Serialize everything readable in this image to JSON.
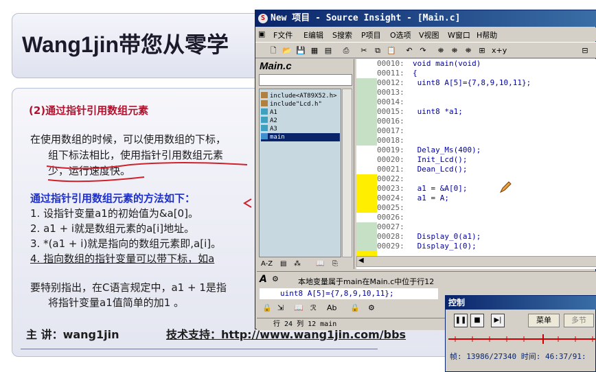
{
  "slide": {
    "title": "Wang1jin带您从零学",
    "heading": "(2)通过指针引用数组元素",
    "para1_line1": "在使用数组的时候，可以使用数组的下标，",
    "para1_line2": "组下标法相比，使用指针引用数组元素",
    "para1_line3": "少，运行速度快。",
    "method_heading": "通过指针引用数组元素的方法如下：",
    "list": [
      "1.  设指针变量a1的初始值为&a[0]。",
      "2.  a1 + i就是数组元素的a[i]地址。",
      "3.  *(a1 + i)就是指向的数组元素即,a[i]。",
      "4.  指向数组的指针变量可以带下标，如a"
    ],
    "note_line1": "要特别指出，在C语言规定中，a1 + 1是指",
    "note_line2": "将指针变量a1值简单的加1 。",
    "footer_speaker": "主 讲：wang1jin",
    "footer_support": "技术支持：http://www.wang1jin.com/bbs"
  },
  "ide": {
    "title": "New 项目 - Source Insight - [Main.c]",
    "menu": [
      "F文件",
      "E编辑",
      "S搜索",
      "P项目",
      "O选项",
      "V视图",
      "W窗口",
      "H帮助"
    ],
    "symbol_title": "Main.c",
    "symbols": [
      {
        "label": "include<AT89X52.h>",
        "kind": "include"
      },
      {
        "label": "include\"Lcd.h\"",
        "kind": "include"
      },
      {
        "label": "A1",
        "kind": "var"
      },
      {
        "label": "A2",
        "kind": "var"
      },
      {
        "label": "A3",
        "kind": "var"
      },
      {
        "label": "main",
        "kind": "func",
        "selected": true
      }
    ],
    "code_lines": [
      {
        "num": "00010:",
        "text": "void main(void)"
      },
      {
        "num": "00011:",
        "text": "{"
      },
      {
        "num": "00012:",
        "text": "    uint8 A[5]={7,8,9,10,11};"
      },
      {
        "num": "00013:",
        "text": ""
      },
      {
        "num": "00014:",
        "text": ""
      },
      {
        "num": "00015:",
        "text": "    uint8 *a1;"
      },
      {
        "num": "00016:",
        "text": ""
      },
      {
        "num": "00017:",
        "text": ""
      },
      {
        "num": "00018:",
        "text": ""
      },
      {
        "num": "00019:",
        "text": "    Delay_Ms(400);"
      },
      {
        "num": "00020:",
        "text": "    Init_Lcd();"
      },
      {
        "num": "00021:",
        "text": "    Dean_Lcd();"
      },
      {
        "num": "00022:",
        "text": ""
      },
      {
        "num": "00023:",
        "text": "    a1 = &A[0];"
      },
      {
        "num": "00024:",
        "text": "    a1 = A;"
      },
      {
        "num": "00025:",
        "text": ""
      },
      {
        "num": "00026:",
        "text": ""
      },
      {
        "num": "00027:",
        "text": ""
      },
      {
        "num": "00028:",
        "text": "    Display_0(a1);"
      },
      {
        "num": "00029:",
        "text": "    Display_1(0);"
      }
    ],
    "context_label": "本地变量属于main在Main.c中位于行12",
    "context_code": "uint8 A[5]={7,8,9,10,11};",
    "status": "行 24  列 12   main"
  },
  "control": {
    "title": "控制",
    "menu_button": "菜单",
    "multi_button": "多节",
    "info": "帧: 13986/27340 时间: 46:37/91:"
  }
}
